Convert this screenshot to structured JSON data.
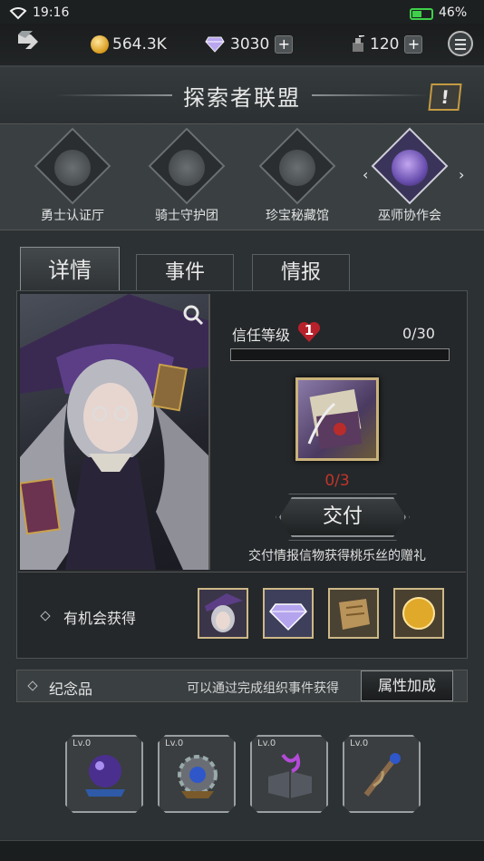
{
  "status": {
    "time": "19:16",
    "battery": "46%",
    "battery_level": 0.46
  },
  "resources": {
    "gold": "564.3K",
    "gems": "3030",
    "stamina": "120",
    "gold_icon": "gold-coin-icon",
    "gem_icon": "diamond-icon",
    "stamina_icon": "ink-bottle-icon"
  },
  "title": "探索者联盟",
  "guilds": [
    {
      "label": "勇士认证厅",
      "icon": "warrior-emblem-icon",
      "active": false
    },
    {
      "label": "骑士守护团",
      "icon": "knight-helmet-icon",
      "active": false
    },
    {
      "label": "珍宝秘藏馆",
      "icon": "treasure-emblem-icon",
      "active": false
    },
    {
      "label": "巫师协作会",
      "icon": "wizard-hat-icon",
      "active": true
    }
  ],
  "tabs": [
    {
      "label": "详情",
      "active": true
    },
    {
      "label": "事件",
      "active": false
    },
    {
      "label": "情报",
      "active": false
    }
  ],
  "trust": {
    "label": "信任等级",
    "level": "1",
    "progress": "0/30",
    "fraction": 0.0
  },
  "delivery": {
    "item_icon": "sealed-letter-icon",
    "count": "0/3",
    "button": "交付",
    "hint": "交付情报信物获得桃乐丝的赠礼"
  },
  "chance": {
    "label": "有机会获得",
    "rewards": [
      "portrait-reward-icon",
      "diamond-icon",
      "parchment-icon",
      "gold-coin-icon"
    ]
  },
  "memento": {
    "label": "纪念品",
    "hint": "可以通过完成组织事件获得",
    "button": "属性加成",
    "relics": [
      {
        "level": "Lv.0",
        "icon": "crystal-ball-icon"
      },
      {
        "level": "Lv.0",
        "icon": "gear-gem-icon"
      },
      {
        "level": "Lv.0",
        "icon": "spellbook-icon"
      },
      {
        "level": "Lv.0",
        "icon": "magic-staff-icon"
      }
    ]
  },
  "colors": {
    "accent_gold": "#c9b27b",
    "trust_red": "#c22",
    "count_red": "#c0352a"
  }
}
